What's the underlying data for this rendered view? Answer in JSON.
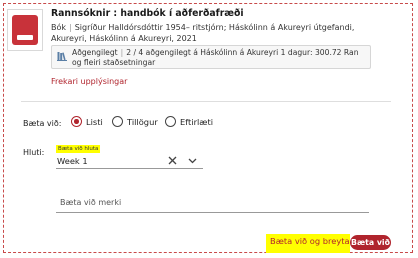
{
  "book": {
    "title": "Rannsóknir : handbók í aðferðafræði",
    "type": "Bók",
    "details": "Sigríður Halldórsdóttir 1954– ritstjórn; Háskólinn á Akureyri útgefandi, Akureyri, Háskólinn á Akureyri, 2021",
    "availability_status": "Aðgengilegt",
    "availability_text": "2 / 4 aðgengilegt á Háskólinn á Akureyri 1 dagur: 300.72 Ran og fleiri staðsetningar",
    "more_info": "Frekari upplýsingar"
  },
  "form": {
    "add_to_label": "Bæta við:",
    "options": [
      {
        "label": "Listi",
        "checked": true
      },
      {
        "label": "Tillögur",
        "checked": false
      },
      {
        "label": "Eftirlæti",
        "checked": false
      }
    ],
    "section_label": "Hluti:",
    "section_field_label": "Bæta við hluta",
    "section_value": "Week 1",
    "note_placeholder": "Bæta við merki"
  },
  "buttons": {
    "add_and_edit": "Bæta við og breyta",
    "add": "Bæta við"
  },
  "colors": {
    "accent": "#b0242d",
    "highlight": "#ffff00"
  }
}
